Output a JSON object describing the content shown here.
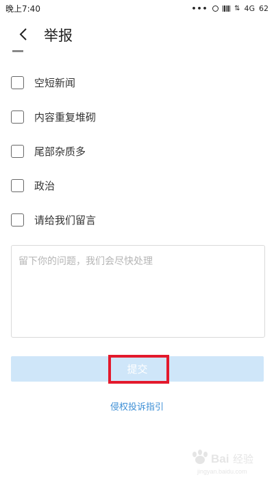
{
  "status_bar": {
    "time": "晚上7:40",
    "network": "4G",
    "battery": "62",
    "icons": [
      "more-dots-icon",
      "alarm-icon",
      "signal-icon",
      "data-arrows-icon"
    ]
  },
  "header": {
    "title": "举报",
    "back_icon": "chevron-left-icon"
  },
  "options": [
    {
      "label": "空短新闻",
      "checked": false
    },
    {
      "label": "内容重复堆砌",
      "checked": false
    },
    {
      "label": "尾部杂质多",
      "checked": false
    },
    {
      "label": "政治",
      "checked": false
    },
    {
      "label": "请给我们留言",
      "checked": false
    }
  ],
  "feedback": {
    "value": "",
    "placeholder": "留下你的问题，我们会尽快处理"
  },
  "submit": {
    "label": "提交",
    "button_color": "#cfe6f9",
    "highlight_color": "#e3192c"
  },
  "guide_link": "侵权投诉指引",
  "watermark": {
    "text": "Baidu经验",
    "url_text": "jingyan.baidu.com"
  }
}
